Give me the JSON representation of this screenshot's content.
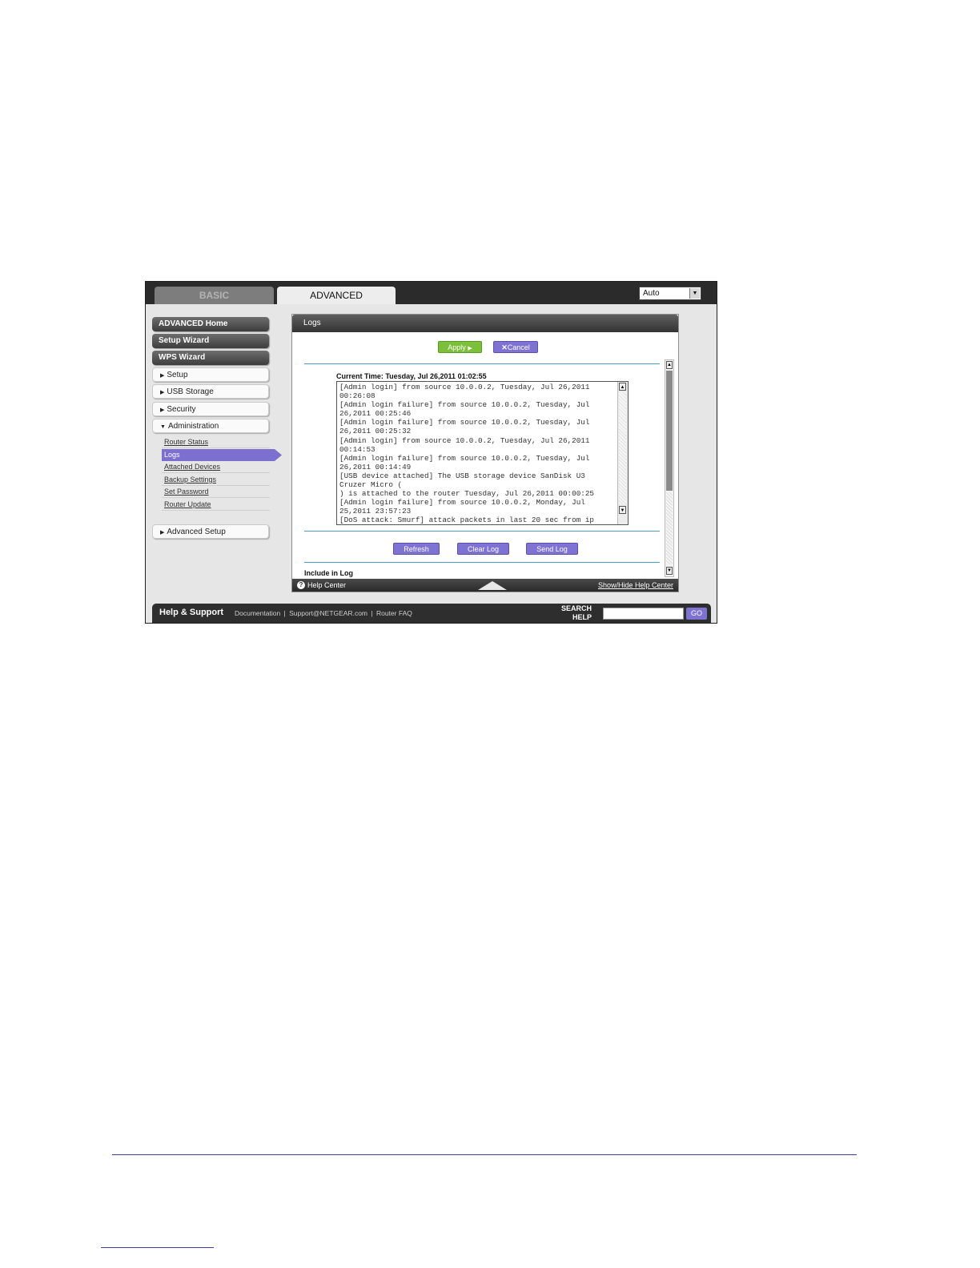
{
  "tabs": {
    "basic": "BASIC",
    "advanced": "ADVANCED"
  },
  "language": {
    "selected": "Auto"
  },
  "sidebar": {
    "top": [
      "ADVANCED Home",
      "Setup Wizard",
      "WPS Wizard"
    ],
    "sections": [
      "Setup",
      "USB Storage",
      "Security",
      "Administration"
    ],
    "admin_items": [
      "Router Status",
      "Logs",
      "Attached Devices",
      "Backup Settings",
      "Set Password",
      "Router Update"
    ],
    "advanced_setup": "Advanced Setup"
  },
  "panel": {
    "title": "Logs",
    "apply": "Apply",
    "cancel": "Cancel",
    "current_time": "Current Time: Tuesday, Jul 26,2011 01:02:55",
    "log_text": "[Admin login] from source 10.0.0.2, Tuesday, Jul 26,2011 00:26:08\n[Admin login failure] from source 10.0.0.2, Tuesday, Jul 26,2011 00:25:46\n[Admin login failure] from source 10.0.0.2, Tuesday, Jul 26,2011 00:25:32\n[Admin login] from source 10.0.0.2, Tuesday, Jul 26,2011 00:14:53\n[Admin login failure] from source 10.0.0.2, Tuesday, Jul 26,2011 00:14:49\n[USB device attached] The USB storage device SanDisk U3 Cruzer Micro (\n) is attached to the router Tuesday, Jul 26,2011 00:00:25\n[Admin login failure] from source 10.0.0.2, Monday, Jul 25,2011 23:57:23\n[DoS attack: Smurf] attack packets in last 20 sec from ip",
    "refresh": "Refresh",
    "clear_log": "Clear Log",
    "send_log": "Send Log",
    "include_in_log": "Include in Log"
  },
  "helpbar": {
    "label": "Help Center",
    "toggle": "Show/Hide Help Center"
  },
  "footer": {
    "title": "Help & Support",
    "links": [
      "Documentation",
      "Support@NETGEAR.com",
      "Router FAQ"
    ],
    "search_line1": "SEARCH",
    "search_line2": "HELP",
    "go": "GO"
  }
}
